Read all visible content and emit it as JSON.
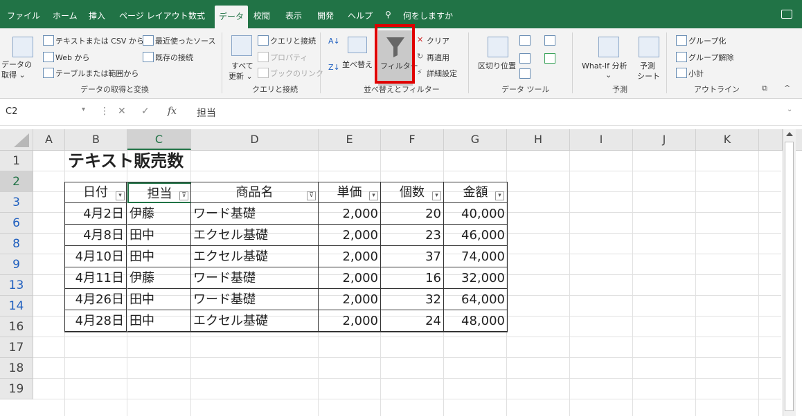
{
  "ribbon_tabs": [
    "ファイル",
    "ホーム",
    "挿入",
    "ページ レイアウト",
    "数式",
    "データ",
    "校閲",
    "表示",
    "開発",
    "ヘルプ",
    "何をしますか"
  ],
  "active_tab": "データ",
  "ribbon": {
    "get_data": {
      "big": "データの",
      "big2": "取得 ⌄",
      "text_csv": "テキストまたは CSV から",
      "web": "Web から",
      "table": "テーブルまたは範囲から",
      "recent": "最近使ったソース",
      "existing": "既存の接続",
      "label": "データの取得と変換"
    },
    "queries": {
      "refresh1": "すべて",
      "refresh2": "更新 ⌄",
      "conn": "クエリと接続",
      "props": "プロパティ",
      "links": "ブックのリンク",
      "label": "クエリと接続"
    },
    "sort_filter": {
      "sort": "並べ替え",
      "filter": "フィルター",
      "clear": "クリア",
      "reapply": "再適用",
      "advanced": "詳細設定",
      "label": "並べ替えとフィルター"
    },
    "data_tools": {
      "split": "区切り位置",
      "label": "データ ツール"
    },
    "forecast": {
      "whatif": "What-If 分析",
      "whatif2": "⌄",
      "sheet1": "予測",
      "sheet2": "シート",
      "label": "予測"
    },
    "outline": {
      "group": "グループ化",
      "ungroup": "グループ解除",
      "subtotal": "小計",
      "label": "アウトライン"
    }
  },
  "formula_bar": {
    "name_box": "C2",
    "fx": "fx",
    "content": "担当"
  },
  "columns": [
    "A",
    "B",
    "C",
    "D",
    "E",
    "F",
    "G",
    "H",
    "I",
    "J",
    "K"
  ],
  "selected_column": "C",
  "row_headers": [
    "1",
    "2",
    "3",
    "6",
    "8",
    "9",
    "13",
    "14",
    "16",
    "17",
    "18",
    "19"
  ],
  "filtered_rows": [
    "3",
    "6",
    "8",
    "9",
    "13",
    "14"
  ],
  "sheet": {
    "title": "テキスト販売数",
    "headers": [
      "日付",
      "担当",
      "商品名",
      "単価",
      "個数",
      "金額"
    ],
    "rows": [
      [
        "4月2日",
        "伊藤",
        "ワード基礎",
        "2,000",
        "20",
        "40,000"
      ],
      [
        "4月8日",
        "田中",
        "エクセル基礎",
        "2,000",
        "23",
        "46,000"
      ],
      [
        "4月10日",
        "田中",
        "エクセル基礎",
        "2,000",
        "37",
        "74,000"
      ],
      [
        "4月11日",
        "伊藤",
        "ワード基礎",
        "2,000",
        "16",
        "32,000"
      ],
      [
        "4月26日",
        "田中",
        "ワード基礎",
        "2,000",
        "32",
        "64,000"
      ],
      [
        "4月28日",
        "田中",
        "エクセル基礎",
        "2,000",
        "24",
        "48,000"
      ]
    ]
  },
  "colors": {
    "excel_green": "#217346",
    "highlight_red": "#e00000",
    "filtered_row_number": "#1f5fbf"
  }
}
